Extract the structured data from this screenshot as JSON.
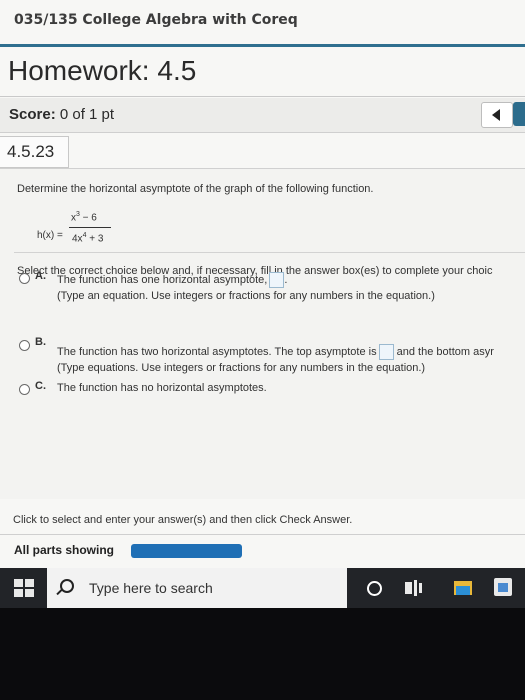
{
  "header": {
    "course": "035/135 College Algebra with Coreq",
    "homework_title": "Homework: 4.5"
  },
  "score": {
    "label": "Score:",
    "value": "0 of 1 pt"
  },
  "question": {
    "number": "4.5.23",
    "prompt": "Determine the horizontal asymptote of the graph of the following function.",
    "func_lhs": "h(x) =",
    "numerator_base": "x",
    "numerator_exp": "3",
    "numerator_rest": " − 6",
    "denominator_base": "4x",
    "denominator_exp": "4",
    "denominator_rest": " + 3",
    "instruction": "Select the correct choice below and, if necessary, fill in the answer box(es) to complete your choic"
  },
  "options": [
    {
      "letter": "A.",
      "line1": "The function has one horizontal asymptote,",
      "line1_after": ".",
      "line2": "(Type an equation. Use integers or fractions for any numbers in the equation.)"
    },
    {
      "letter": "B.",
      "line1": "The function has two horizontal asymptotes. The top asymptote is",
      "line1_after": "and the bottom asyr",
      "line2": "(Type equations. Use integers or fractions for any numbers in the equation.)"
    },
    {
      "letter": "C.",
      "line1": "The function has no horizontal asymptotes."
    }
  ],
  "footer": {
    "help_text": "Click to select and enter your answer(s) and then click Check Answer.",
    "parts_label": "All parts showing"
  },
  "taskbar": {
    "search_placeholder": "Type here to search"
  },
  "colors": {
    "accent": "#2f6f8f",
    "progress": "#1f6fb5"
  }
}
